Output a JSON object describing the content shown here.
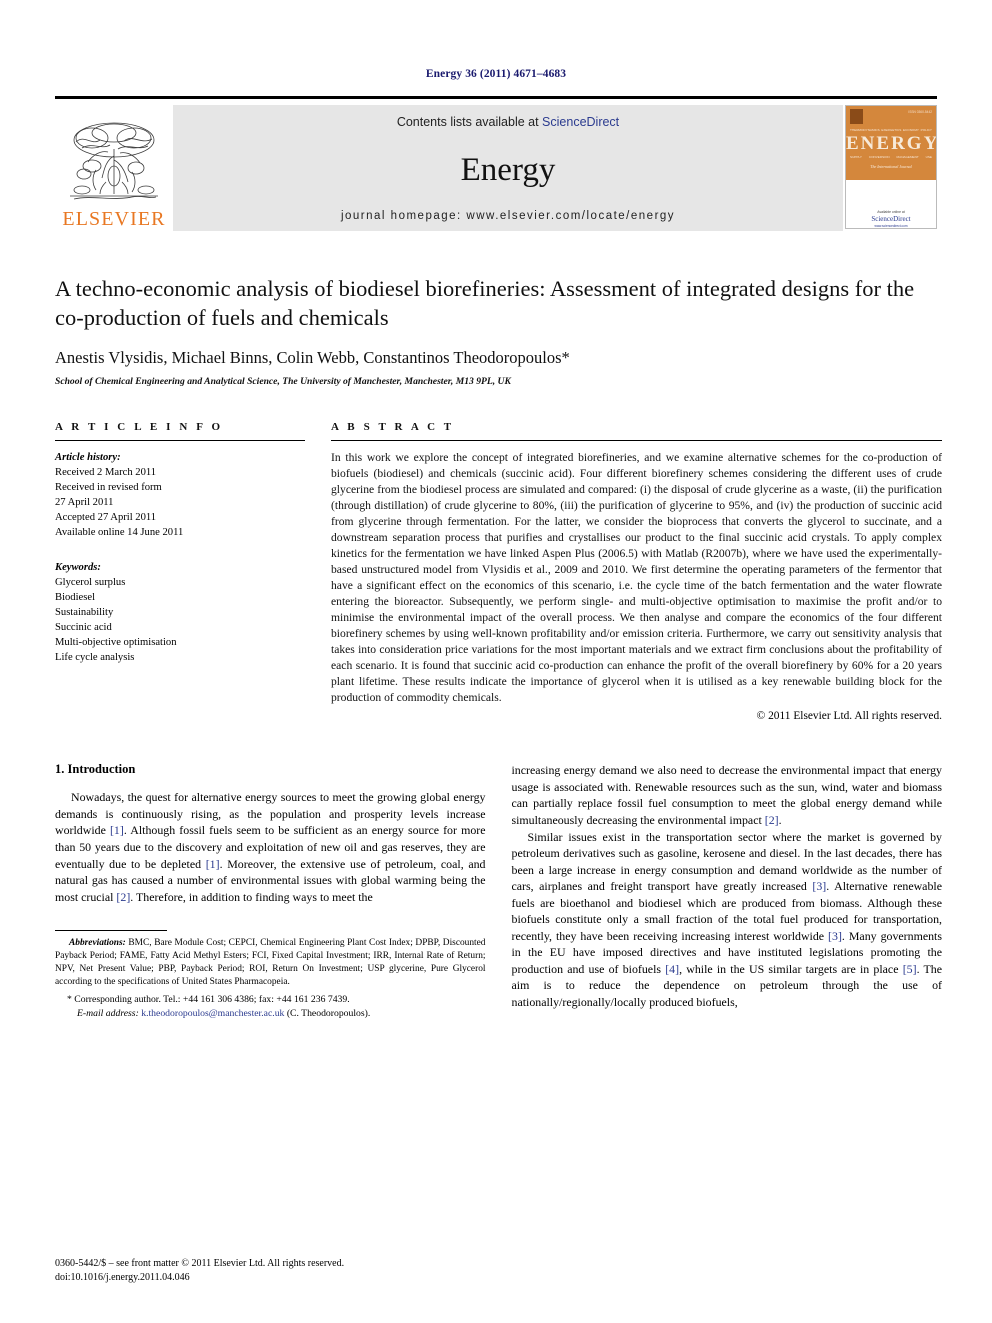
{
  "running_head": "Energy 36 (2011) 4671–4683",
  "masthead": {
    "publisher_name": "ELSEVIER",
    "contents_prefix": "Contents lists available at ",
    "sciencedirect": "ScienceDirect",
    "journal_name": "Energy",
    "homepage": "journal homepage: www.elsevier.com/locate/energy",
    "cover": {
      "title": "ENERGY",
      "issn": "ISSN 0360-5442",
      "tagline": "The International Journal",
      "topwords": [
        "THERMODYNAMICS",
        "EXERGETICS",
        "ECONOMY",
        "POLICY"
      ],
      "botwords": [
        "SUPPLY",
        "CONVERSION",
        "MANAGEMENT",
        "USE"
      ],
      "available_at": "Available online at",
      "sd_logo": "ScienceDirect",
      "sd_url": "www.sciencedirect.com"
    }
  },
  "article": {
    "title": "A techno-economic analysis of biodiesel biorefineries: Assessment of integrated designs for the co-production of fuels and chemicals",
    "authors": "Anestis Vlysidis, Michael Binns, Colin Webb, Constantinos Theodoropoulos*",
    "affiliation": "School of Chemical Engineering and Analytical Science, The University of Manchester, Manchester, M13 9PL, UK"
  },
  "article_info": {
    "heading": "A R T I C L E   I N F O",
    "history_label": "Article history:",
    "history": [
      "Received 2 March 2011",
      "Received in revised form",
      "27 April 2011",
      "Accepted 27 April 2011",
      "Available online 14 June 2011"
    ],
    "keywords_label": "Keywords:",
    "keywords": [
      "Glycerol surplus",
      "Biodiesel",
      "Sustainability",
      "Succinic acid",
      "Multi-objective optimisation",
      "Life cycle analysis"
    ]
  },
  "abstract": {
    "heading": "A B S T R A C T",
    "text": "In this work we explore the concept of integrated biorefineries, and we examine alternative schemes for the co-production of biofuels (biodiesel) and chemicals (succinic acid). Four different biorefinery schemes considering the different uses of crude glycerine from the biodiesel process are simulated and compared: (i) the disposal of crude glycerine as a waste, (ii) the purification (through distillation) of crude glycerine to 80%, (iii) the purification of glycerine to 95%, and (iv) the production of succinic acid from glycerine through fermentation. For the latter, we consider the bioprocess that converts the glycerol to succinate, and a downstream separation process that purifies and crystallises our product to the final succinic acid crystals. To apply complex kinetics for the fermentation we have linked Aspen Plus (2006.5) with Matlab (R2007b), where we have used the experimentally-based unstructured model from Vlysidis et al., 2009 and 2010. We first determine the operating parameters of the fermentor that have a significant effect on the economics of this scenario, i.e. the cycle time of the batch fermentation and the water flowrate entering the bioreactor. Subsequently, we perform single- and multi-objective optimisation to maximise the profit and/or to minimise the environmental impact of the overall process. We then analyse and compare the economics of the four different biorefinery schemes by using well-known profitability and/or emission criteria. Furthermore, we carry out sensitivity analysis that takes into consideration price variations for the most important materials and we extract firm conclusions about the profitability of each scenario. It is found that succinic acid co-production can enhance the profit of the overall biorefinery by 60% for a 20 years plant lifetime. These results indicate the importance of glycerol when it is utilised as a key renewable building block for the production of commodity chemicals.",
    "copyright": "© 2011 Elsevier Ltd. All rights reserved."
  },
  "introduction": {
    "section_title": "1.  Introduction",
    "left_para_1_a": "Nowadays, the quest for alternative energy sources to meet the growing global energy demands is continuously rising, as the population and prosperity levels increase worldwide ",
    "left_ref_1": "[1]",
    "left_para_1_b": ". Although fossil fuels seem to be sufficient as an energy source for more than 50 years due to the discovery and exploitation of new oil and gas reserves, they are eventually due to be depleted ",
    "left_ref_2": "[1]",
    "left_para_1_c": ". Moreover, the extensive use of petroleum, coal, and natural gas has caused a number of environmental issues with global warming being the most crucial ",
    "left_ref_3": "[2]",
    "left_para_1_d": ". Therefore, in addition to finding ways to meet the",
    "right_para_1_a": "increasing energy demand we also need to decrease the environmental impact that energy usage is associated with. Renewable resources such as the sun, wind, water and biomass can partially replace fossil fuel consumption to meet the global energy demand while simultaneously decreasing the environmental impact ",
    "right_ref_1": "[2]",
    "right_para_1_b": ".",
    "right_para_2_a": "Similar issues exist in the transportation sector where the market is governed by petroleum derivatives such as gasoline, kerosene and diesel. In the last decades, there has been a large increase in energy consumption and demand worldwide as the number of cars, airplanes and freight transport have greatly increased ",
    "right_ref_2": "[3]",
    "right_para_2_b": ". Alternative renewable fuels are bioethanol and biodiesel which are produced from biomass. Although these biofuels constitute only a small fraction of the total fuel produced for transportation, recently, they have been receiving increasing interest worldwide ",
    "right_ref_3": "[3]",
    "right_para_2_c": ". Many governments in the EU have imposed directives and have instituted legislations promoting the production and use of biofuels ",
    "right_ref_4": "[4]",
    "right_para_2_d": ", while in the US similar targets are in place ",
    "right_ref_5": "[5]",
    "right_para_2_e": ". The aim is to reduce the dependence on petroleum through the use of nationally/regionally/locally produced biofuels,"
  },
  "footnotes": {
    "abbreviations_label": "Abbreviations:",
    "abbreviations_text": " BMC, Bare Module Cost; CEPCI, Chemical Engineering Plant Cost Index; DPBP, Discounted Payback Period; FAME, Fatty Acid Methyl Esters; FCI, Fixed Capital Investment; IRR, Internal Rate of Return; NPV, Net Present Value; PBP, Payback Period; ROI, Return On Investment; USP glycerine, Pure Glycerol according to the specifications of United States Pharmacopeia.",
    "corresponding": "* Corresponding author. Tel.: +44 161 306 4386; fax: +44 161 236 7439.",
    "email_label": "E-mail address:",
    "email_address": "k.theodoropoulos@manchester.ac.uk",
    "email_suffix": " (C. Theodoropoulos)."
  },
  "page_footer": {
    "line1": "0360-5442/$ – see front matter © 2011 Elsevier Ltd. All rights reserved.",
    "line2": "doi:10.1016/j.energy.2011.04.046"
  }
}
